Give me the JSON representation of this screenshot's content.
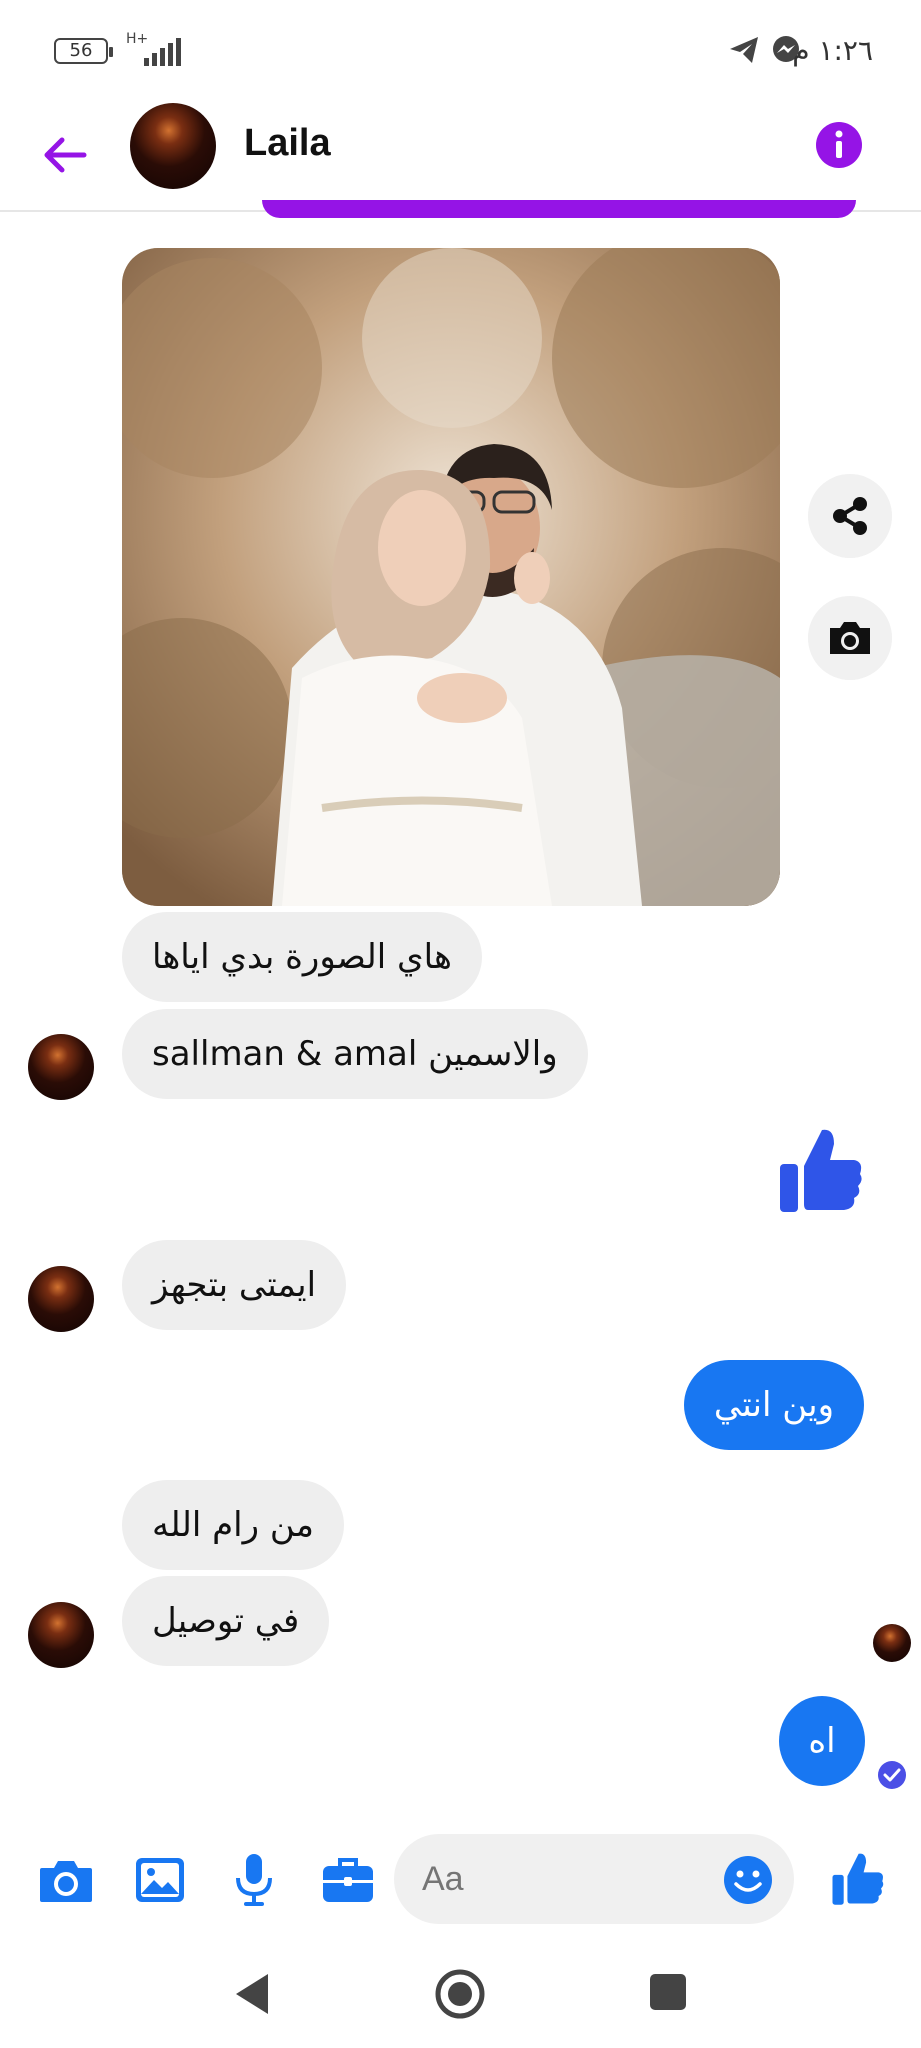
{
  "status_bar": {
    "battery": "56",
    "network": "H+",
    "time": "١:٢٦ م",
    "icons": [
      "telegram-icon",
      "messenger-icon"
    ]
  },
  "header": {
    "contact_name": "Laila",
    "icons": [
      "back-arrow-icon",
      "info-icon"
    ]
  },
  "conversation": {
    "image_description_icons": [
      "share-icon",
      "camera-icon"
    ],
    "messages": [
      {
        "from": "them",
        "text": "هاي الصورة بدي اياها"
      },
      {
        "from": "them",
        "text": "sallman & amal والاسمين"
      },
      {
        "from": "me",
        "type": "like-sticker"
      },
      {
        "from": "them",
        "text": "ايمتى بتجهز"
      },
      {
        "from": "me",
        "text": "وين انتي"
      },
      {
        "from": "them",
        "text": "من رام الله"
      },
      {
        "from": "them",
        "text": "في توصيل"
      },
      {
        "from": "me",
        "text": "اه"
      }
    ]
  },
  "composer": {
    "placeholder": "Aa",
    "icons": [
      "camera-icon",
      "gallery-icon",
      "microphone-icon",
      "briefcase-icon",
      "emoji-icon",
      "like-icon"
    ]
  },
  "colors": {
    "accent_purple": "#9514e6",
    "messenger_blue": "#1877f2",
    "like_blue": "#2f55e8",
    "bubble_gray": "#eeeeee"
  }
}
